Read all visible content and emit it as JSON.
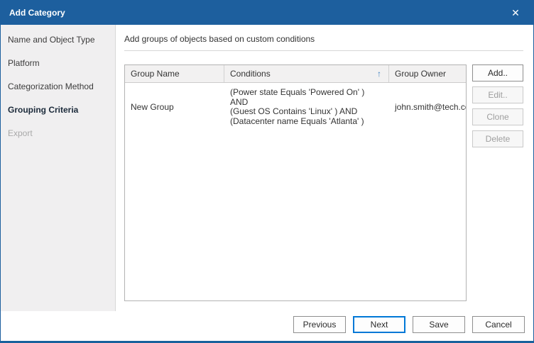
{
  "window": {
    "title": "Add Category",
    "close_icon": "✕",
    "accent_color": "#1d5f9e"
  },
  "sidebar": {
    "items": [
      {
        "label": "Name and Object Type",
        "state": "enabled"
      },
      {
        "label": "Platform",
        "state": "enabled"
      },
      {
        "label": "Categorization Method",
        "state": "enabled"
      },
      {
        "label": "Grouping Criteria",
        "state": "active"
      },
      {
        "label": "Export",
        "state": "disabled"
      }
    ]
  },
  "main": {
    "description": "Add groups of objects based on custom conditions",
    "table": {
      "columns": [
        {
          "label": "Group Name"
        },
        {
          "label": "Conditions",
          "sort": "asc",
          "sort_icon": "↑"
        },
        {
          "label": "Group Owner"
        }
      ],
      "rows": [
        {
          "group_name": "New Group",
          "conditions": [
            "(Power state Equals 'Powered On' ) AND",
            "(Guest OS Contains 'Linux' ) AND",
            "(Datacenter name Equals 'Atlanta' )"
          ],
          "group_owner": "john.smith@tech.com"
        }
      ]
    },
    "actions": [
      {
        "label": "Add..",
        "enabled": true
      },
      {
        "label": "Edit..",
        "enabled": false
      },
      {
        "label": "Clone",
        "enabled": false
      },
      {
        "label": "Delete",
        "enabled": false
      }
    ]
  },
  "footer": {
    "buttons": [
      {
        "label": "Previous",
        "enabled": true,
        "focused": false
      },
      {
        "label": "Next",
        "enabled": true,
        "focused": true
      },
      {
        "label": "Save",
        "enabled": true,
        "focused": false
      },
      {
        "label": "Cancel",
        "enabled": true,
        "focused": false
      }
    ]
  }
}
